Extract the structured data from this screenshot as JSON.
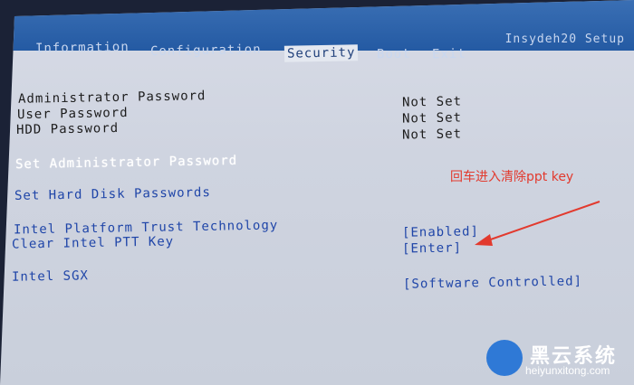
{
  "vendor": "Insydeh20 Setup",
  "tabs": [
    {
      "label": "Information",
      "active": false
    },
    {
      "label": "Configuration",
      "active": false
    },
    {
      "label": "Security",
      "active": true
    },
    {
      "label": "Boot",
      "active": false
    },
    {
      "label": "Exit",
      "active": false
    }
  ],
  "status": {
    "admin_password": {
      "label": "Administrator Password",
      "value": "Not Set"
    },
    "user_password": {
      "label": "User Password",
      "value": "Not Set"
    },
    "hdd_password": {
      "label": "HDD Password",
      "value": "Not Set"
    }
  },
  "items": {
    "set_admin": "Set Administrator Password",
    "set_hdd": "Set Hard Disk Passwords",
    "ptt": {
      "label": "Intel Platform Trust Technology",
      "value": "[Enabled]"
    },
    "clear_ptt": {
      "label": "Clear Intel PTT Key",
      "value": "[Enter]"
    },
    "sgx": {
      "label": "Intel SGX",
      "value": "[Software Controlled]"
    }
  },
  "annotation": "回车进入清除ppt key",
  "watermark": {
    "title": "黑云系统",
    "site": "heiyunxitong.com"
  },
  "colors": {
    "bios_background": "#d7dbe6",
    "header": "#245aa3",
    "option_text": "#1f45a8",
    "annotation": "#e23a2e"
  }
}
